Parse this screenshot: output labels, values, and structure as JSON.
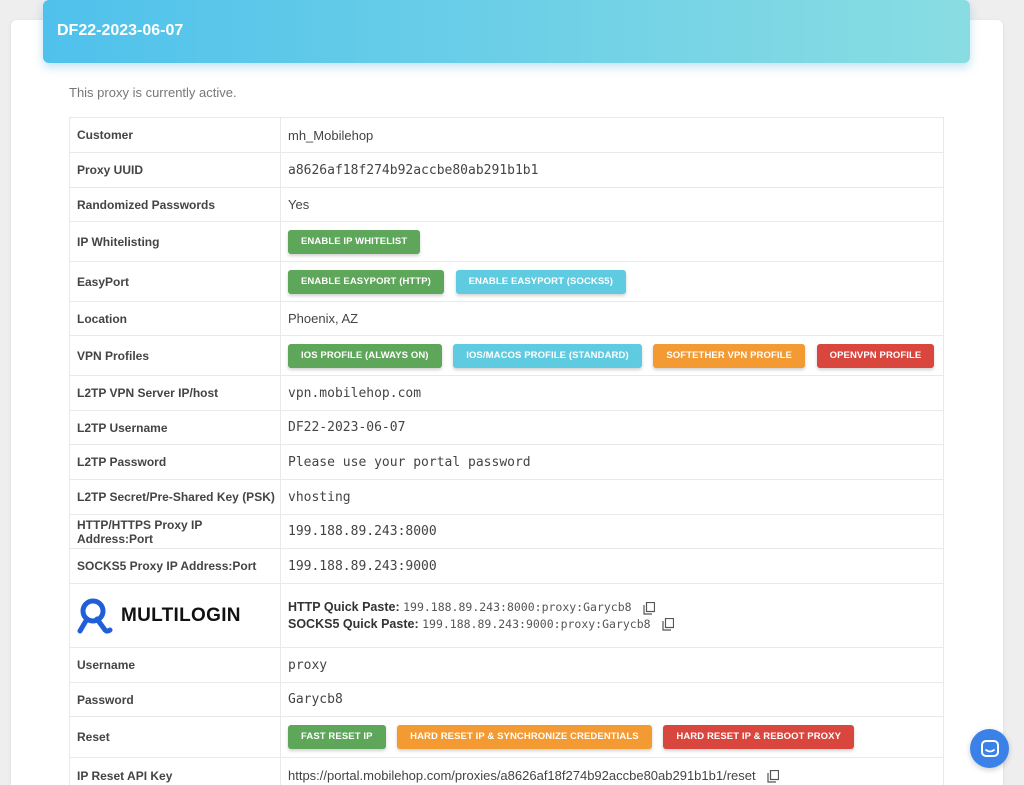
{
  "header": {
    "title": "DF22-2023-06-07"
  },
  "status_text": "This proxy is currently active.",
  "rows": {
    "customer": {
      "label": "Customer",
      "value": "mh_Mobilehop"
    },
    "uuid": {
      "label": "Proxy UUID",
      "value": "a8626af18f274b92accbe80ab291b1b1"
    },
    "randomized": {
      "label": "Randomized Passwords",
      "value": "Yes"
    },
    "whitelist": {
      "label": "IP Whitelisting",
      "button": "ENABLE IP WHITELIST"
    },
    "easyport": {
      "label": "EasyPort",
      "buttons": [
        "ENABLE EASYPORT (HTTP)",
        "ENABLE EASYPORT (SOCKS5)"
      ]
    },
    "location": {
      "label": "Location",
      "value": "Phoenix, AZ"
    },
    "vpn": {
      "label": "VPN Profiles",
      "buttons": [
        "IOS PROFILE (ALWAYS ON)",
        "IOS/MACOS PROFILE (STANDARD)",
        "SOFTETHER VPN PROFILE",
        "OPENVPN PROFILE"
      ]
    },
    "l2tp_host": {
      "label": "L2TP VPN Server IP/host",
      "value": "vpn.mobilehop.com"
    },
    "l2tp_user": {
      "label": "L2TP Username",
      "value": "DF22-2023-06-07"
    },
    "l2tp_pass": {
      "label": "L2TP Password",
      "value": "Please use your portal password"
    },
    "l2tp_psk": {
      "label": "L2TP Secret/Pre-Shared Key (PSK)",
      "value": "vhosting"
    },
    "http_proxy": {
      "label": "HTTP/HTTPS Proxy IP Address:Port",
      "value": "199.188.89.243:8000"
    },
    "socks_proxy": {
      "label": "SOCKS5 Proxy IP Address:Port",
      "value": "199.188.89.243:9000"
    },
    "multilogin": {
      "logo_text": "MULTILOGIN",
      "http_label": "HTTP Quick Paste:",
      "http_value": "199.188.89.243:8000:proxy:Garycb8",
      "socks_label": "SOCKS5 Quick Paste:",
      "socks_value": "199.188.89.243:9000:proxy:Garycb8"
    },
    "username": {
      "label": "Username",
      "value": "proxy"
    },
    "password": {
      "label": "Password",
      "value": "Garycb8"
    },
    "reset": {
      "label": "Reset",
      "buttons": [
        "FAST RESET IP",
        "HARD RESET IP & SYNCHRONIZE CREDENTIALS",
        "HARD RESET IP & REBOOT PROXY"
      ]
    },
    "api_key": {
      "label": "IP Reset API Key",
      "value": "https://portal.mobilehop.com/proxies/a8626af18f274b92accbe80ab291b1b1/reset"
    }
  },
  "colors": {
    "green": "#5ea65a",
    "cyan": "#5fcbe0",
    "orange": "#f39a32",
    "red": "#d9463e",
    "header_start": "#4fc1ec",
    "header_end": "#89dde2",
    "chat": "#3b82e8"
  },
  "icons": {
    "copy": "copy-icon",
    "logo": "multilogin-logo-icon",
    "chat": "chat-icon"
  }
}
